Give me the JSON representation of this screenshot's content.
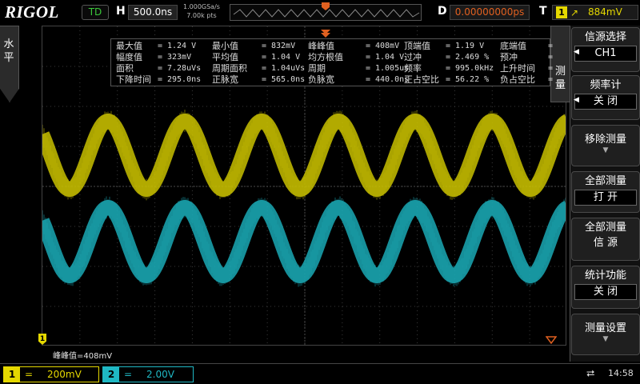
{
  "header": {
    "brand": "RIGOL",
    "run_state": "TD",
    "h_label": "H",
    "timebase": "500.0ns",
    "sample_rate": "1.000GSa/s",
    "memory_depth": "7.00k pts",
    "d_label": "D",
    "delay": "0.00000000ps",
    "t_label": "T",
    "trigger_source": "1",
    "trigger_edge_icon": "rising-edge-icon",
    "trigger_level": "884mV"
  },
  "left_tab": {
    "label": "水平"
  },
  "measurements": [
    [
      {
        "name": "最大值",
        "value": "1.24 V"
      },
      {
        "name": "最小值",
        "value": "832mV"
      },
      {
        "name": "峰峰值",
        "value": "408mV"
      },
      {
        "name": "顶端值",
        "value": "1.19 V"
      },
      {
        "name": "底端值",
        "value": ""
      }
    ],
    [
      {
        "name": "幅度值",
        "value": "323mV"
      },
      {
        "name": "平均值",
        "value": "1.04 V"
      },
      {
        "name": "均方根值",
        "value": "1.04 V"
      },
      {
        "name": "过冲",
        "value": "2.469 %"
      },
      {
        "name": "预冲",
        "value": ""
      }
    ],
    [
      {
        "name": "面积",
        "value": "7.28uVs"
      },
      {
        "name": "周期面积",
        "value": "1.04uVs"
      },
      {
        "name": "周期",
        "value": "1.005us"
      },
      {
        "name": "频率",
        "value": "995.0kHz"
      },
      {
        "name": "上升时间",
        "value": ""
      }
    ],
    [
      {
        "name": "下降时间",
        "value": "295.0ns"
      },
      {
        "name": "正脉宽",
        "value": "565.0ns"
      },
      {
        "name": "负脉宽",
        "value": "440.0ns"
      },
      {
        "name": "正占空比",
        "value": "56.22 %"
      },
      {
        "name": "负占空比",
        "value": ""
      }
    ]
  ],
  "readout": "峰峰值=408mV",
  "ch1_marker": "1",
  "menu": {
    "tab_label": "测量",
    "items": [
      {
        "title": "信源选择",
        "value": "CH1",
        "has_value": true,
        "arrow": true
      },
      {
        "title": "频率计",
        "value": "关  闭",
        "has_value": true,
        "arrow": true
      },
      {
        "title": "移除测量",
        "value": "",
        "has_value": false,
        "down": true
      },
      {
        "title": "全部测量",
        "value": "打  开",
        "has_value": true,
        "arrow": false
      },
      {
        "title": "全部测量",
        "value": "信  源",
        "has_value": true,
        "plain": true
      },
      {
        "title": "统计功能",
        "value": "关  闭",
        "has_value": true,
        "arrow": false
      },
      {
        "title": "测量设置",
        "value": "",
        "has_value": false,
        "down": true
      }
    ]
  },
  "channels": [
    {
      "num": "1",
      "coupling": "=",
      "scale": "200mV",
      "color": "#e5d800"
    },
    {
      "num": "2",
      "coupling": "=",
      "scale": "2.00V",
      "color": "#1fb8c4"
    }
  ],
  "status": {
    "usb_icon": "usb-icon",
    "time": "14:58"
  },
  "colors": {
    "ch1": "#c8c000",
    "ch2": "#1aa8b4",
    "trigger": "#e06020"
  }
}
